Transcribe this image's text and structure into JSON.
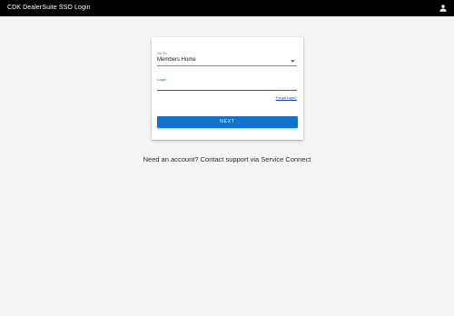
{
  "header": {
    "title": "CDK DealerSuite SSO Login",
    "account_icon": "person-icon"
  },
  "form": {
    "goto": {
      "label": "Go To",
      "selected_value": "Members Home",
      "dropdown_icon": "chevron-down-icon"
    },
    "login": {
      "label": "Login",
      "value": ""
    },
    "forgot_login_label": "Forgot login?",
    "next_button_label": "NEXT"
  },
  "support_message": "Need an account? Contact support via Service Connect",
  "colors": {
    "header_bg": "#000000",
    "page_bg": "#f5f5f5",
    "primary": "#1173cf",
    "focus_blue": "#1565c0",
    "link": "#1a43b8"
  }
}
